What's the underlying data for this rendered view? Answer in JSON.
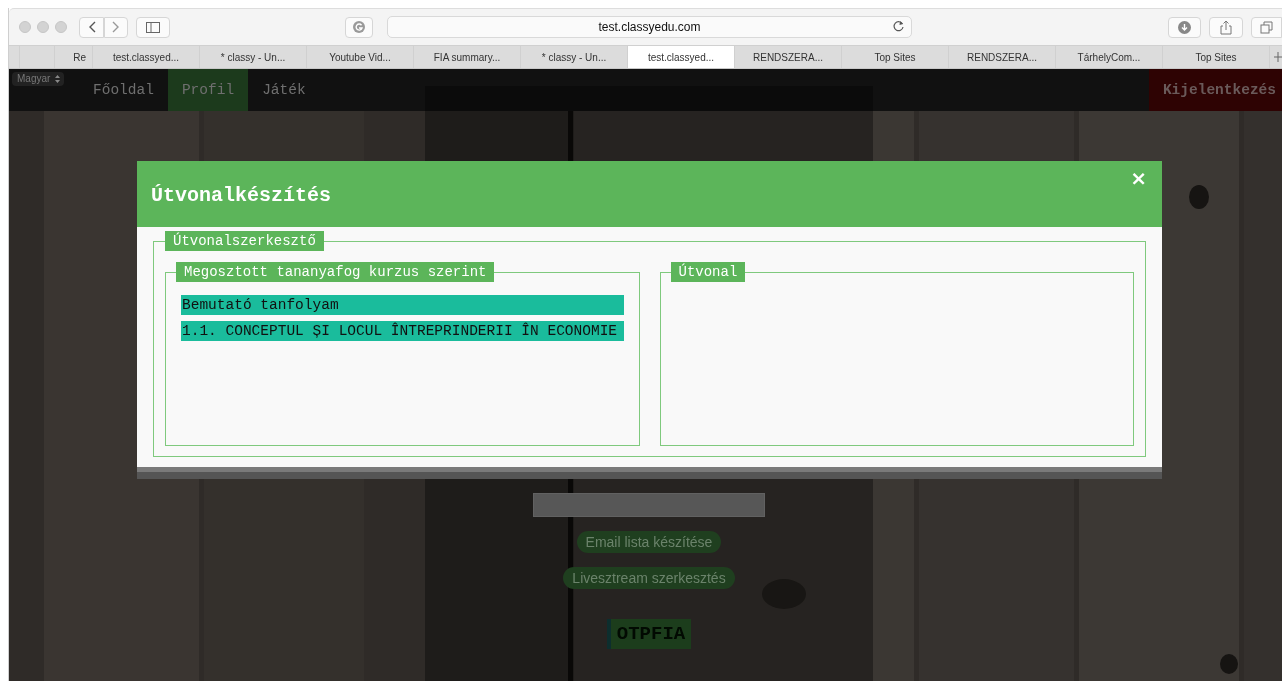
{
  "browser": {
    "url": "test.classyedu.com",
    "tabs": [
      {
        "label": "Re",
        "selected": false
      },
      {
        "label": "test.classyed...",
        "selected": false
      },
      {
        "label": "* classy - Un...",
        "selected": false
      },
      {
        "label": "Youtube Vid...",
        "selected": false
      },
      {
        "label": "FIA summary...",
        "selected": false
      },
      {
        "label": "* classy - Un...",
        "selected": false
      },
      {
        "label": "test.classyed...",
        "selected": true
      },
      {
        "label": "RENDSZERA...",
        "selected": false
      },
      {
        "label": "Top Sites",
        "selected": false
      },
      {
        "label": "RENDSZERA...",
        "selected": false
      },
      {
        "label": "TárhelyCom...",
        "selected": false
      },
      {
        "label": "Top Sites",
        "selected": false
      }
    ]
  },
  "nav": {
    "language": "Magyar",
    "items": [
      {
        "label": "Főoldal",
        "selected": false
      },
      {
        "label": "Profil",
        "selected": true
      },
      {
        "label": "Játék",
        "selected": false
      }
    ],
    "logout": "Kijelentkezés"
  },
  "background": {
    "buttons": [
      "Email lista készítése",
      "Livesztream szerkesztés"
    ],
    "badge": "OTPFIA"
  },
  "modal": {
    "title": "Útvonalkészítés",
    "close": "×",
    "legend": "Útvonalszerkesztő",
    "panels": [
      {
        "legend": "Megosztott tananyafog kurzus szerint",
        "items": [
          "Bemutató tanfolyam",
          "1.1. CONCEPTUL ȘI LOCUL ÎNTREPRINDERII ÎN ECONOMIE"
        ]
      },
      {
        "legend": "Útvonal"
      }
    ]
  }
}
